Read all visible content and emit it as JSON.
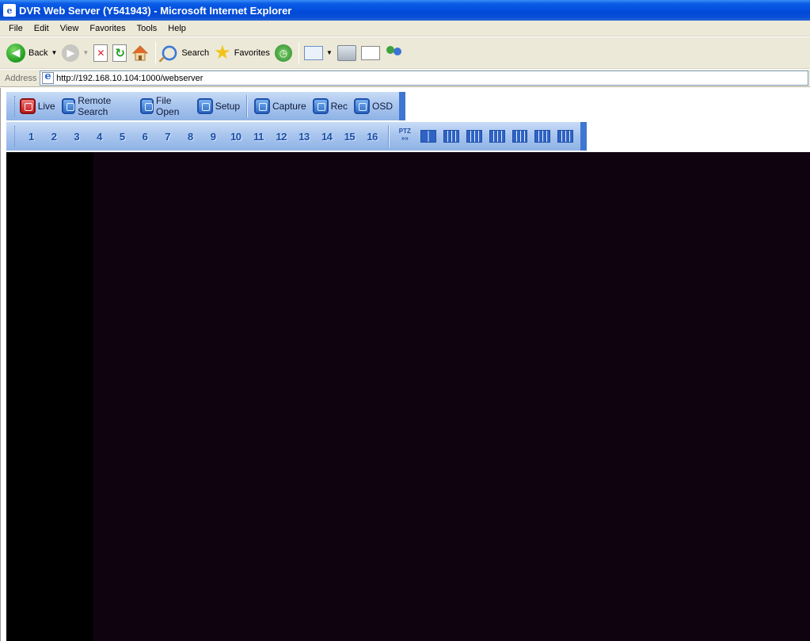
{
  "window": {
    "title": "DVR Web Server (Y541943) - Microsoft Internet Explorer"
  },
  "menu": {
    "items": [
      "File",
      "Edit",
      "View",
      "Favorites",
      "Tools",
      "Help"
    ]
  },
  "toolbar": {
    "back_label": "Back",
    "search_label": "Search",
    "favorites_label": "Favorites"
  },
  "address": {
    "label": "Address",
    "url": "http://192.168.10.104:1000/webserver"
  },
  "dvr": {
    "main_buttons": [
      {
        "label": "Live",
        "icon": "live-icon",
        "color": "#c31a1a"
      },
      {
        "label": "Remote Search",
        "icon": "remote-search-icon"
      },
      {
        "label": "File Open",
        "icon": "file-open-icon"
      },
      {
        "label": "Setup",
        "icon": "setup-icon"
      }
    ],
    "capture_buttons": [
      {
        "label": "Capture",
        "icon": "capture-icon"
      },
      {
        "label": "Rec",
        "icon": "rec-icon"
      },
      {
        "label": "OSD",
        "icon": "osd-icon"
      }
    ],
    "channels": [
      "1",
      "2",
      "3",
      "4",
      "5",
      "6",
      "7",
      "8",
      "9",
      "10",
      "11",
      "12",
      "13",
      "14",
      "15",
      "16"
    ],
    "ptz_label": "PTZ",
    "layouts": [
      "layout-4-icon",
      "layout-6-icon",
      "layout-8-icon",
      "layout-10-icon",
      "layout-9-icon",
      "layout-13-icon",
      "layout-16-icon"
    ]
  },
  "colors": {
    "title_bar": "#0049d8",
    "chrome": "#ece9d8",
    "dvr_toolbar": "#a9c5ee",
    "dvr_accent": "#3f76d1",
    "video_bg": "#0f0310"
  }
}
